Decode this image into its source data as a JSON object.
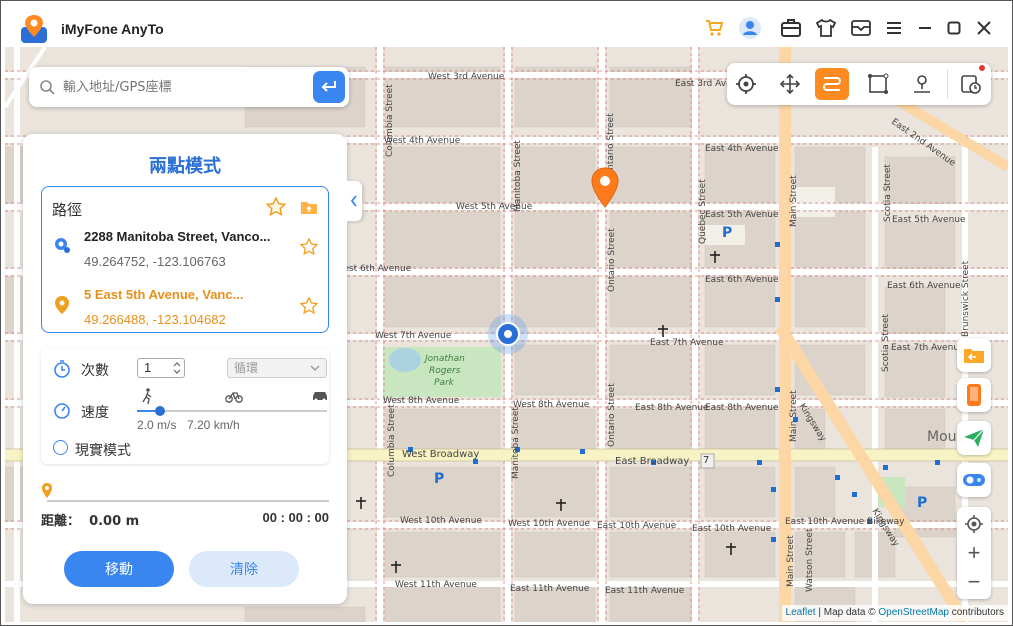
{
  "app": {
    "title": "iMyFone AnyTo"
  },
  "titlebar": {
    "icons": [
      "cart-icon",
      "user-avatar-icon",
      "toolbox-icon",
      "tshirt-icon",
      "mail-icon",
      "menu-icon",
      "minimize-icon",
      "maximize-icon",
      "close-icon"
    ]
  },
  "search": {
    "placeholder": "輸入地址/GPS座標"
  },
  "modes": {
    "items": [
      "teleport-mode",
      "joystick-mode",
      "two-spot-mode",
      "multi-spot-mode",
      "multi-device-mode",
      "history"
    ],
    "active": "two-spot-mode"
  },
  "panel": {
    "title": "兩點模式",
    "route_label": "路徑",
    "start": {
      "name": "2288 Manitoba Street, Vanco...",
      "coord": "49.264752, -123.106763"
    },
    "end": {
      "name": "5 East 5th Avenue, Vanc...",
      "coord": "49.266488, -123.104682"
    },
    "times_label": "次數",
    "times_value": "1",
    "loop_label": "循環",
    "speed_label": "速度",
    "speed_fraction": 0.12,
    "speed_ms": "2.0 m/s",
    "speed_kmh": "7.20 km/h",
    "realistic_label": "現實模式",
    "distance_label": "距離：",
    "distance_value": "0.00 m",
    "time_value": "00 : 00 : 00",
    "move_button": "移動",
    "clear_button": "清除"
  },
  "map": {
    "streets": {
      "w3": "West 3rd Avenue",
      "e3": "East 3rd Avenue",
      "w4": "West 4th Avenue",
      "e4": "East 4th Avenue",
      "w5": "West 5th Avenue",
      "e5": "East 5th Avenue",
      "e5b": "East 5th Avenue",
      "w6": "West 6th Avenue",
      "e6": "East 6th Avenue",
      "e6b": "East 6th Avenue",
      "w7": "West 7th Avenue",
      "e7": "East 7th Avenue",
      "e7b": "East 7th Avenue",
      "w8": "West 8th Avenue",
      "w8b": "West 8th Avenue",
      "e8": "East 8th Avenue",
      "e8b": "East 8th Avenue",
      "wb": "West Broadway",
      "eb": "East Broadway",
      "w10": "West 10th Avenue",
      "w10b": "West 10th Avenue",
      "e10": "East 10th Avenue",
      "e10b": "East 10th Avenue",
      "e10bike": "East 10th Avenue Bikeway",
      "w11": "West 11th Avenue",
      "e11": "East 11th Avenue",
      "e11b": "East 11th Avenue",
      "e2": "East 2nd Avenue",
      "columbia": "Columbia Street",
      "manitoba": "Manitoba Street",
      "ontario": "Ontario Street",
      "quebec": "Quebec Street",
      "main": "Main Street",
      "scotia": "Scotia Street",
      "kingsway": "Kingsway",
      "watson": "Watson Street",
      "brunswick": "Brunswick Street",
      "mount": "Mou"
    },
    "park": [
      "Jonathan",
      "Rogers",
      "Park"
    ],
    "route_badge": "7",
    "parking": "P"
  },
  "side_buttons": [
    "import-gpx-icon",
    "device-icon",
    "send-location-icon",
    "toggle-icon"
  ],
  "zoom": {
    "plus": "+",
    "minus": "−"
  },
  "attribution": {
    "leaflet": "Leaflet",
    "sep1": " | Map data © ",
    "osm": "OpenStreetMap",
    "contrib": " contributors"
  },
  "colors": {
    "accent": "#3a86f0",
    "orange": "#ff8a1f",
    "title": "#2a6fd6"
  }
}
